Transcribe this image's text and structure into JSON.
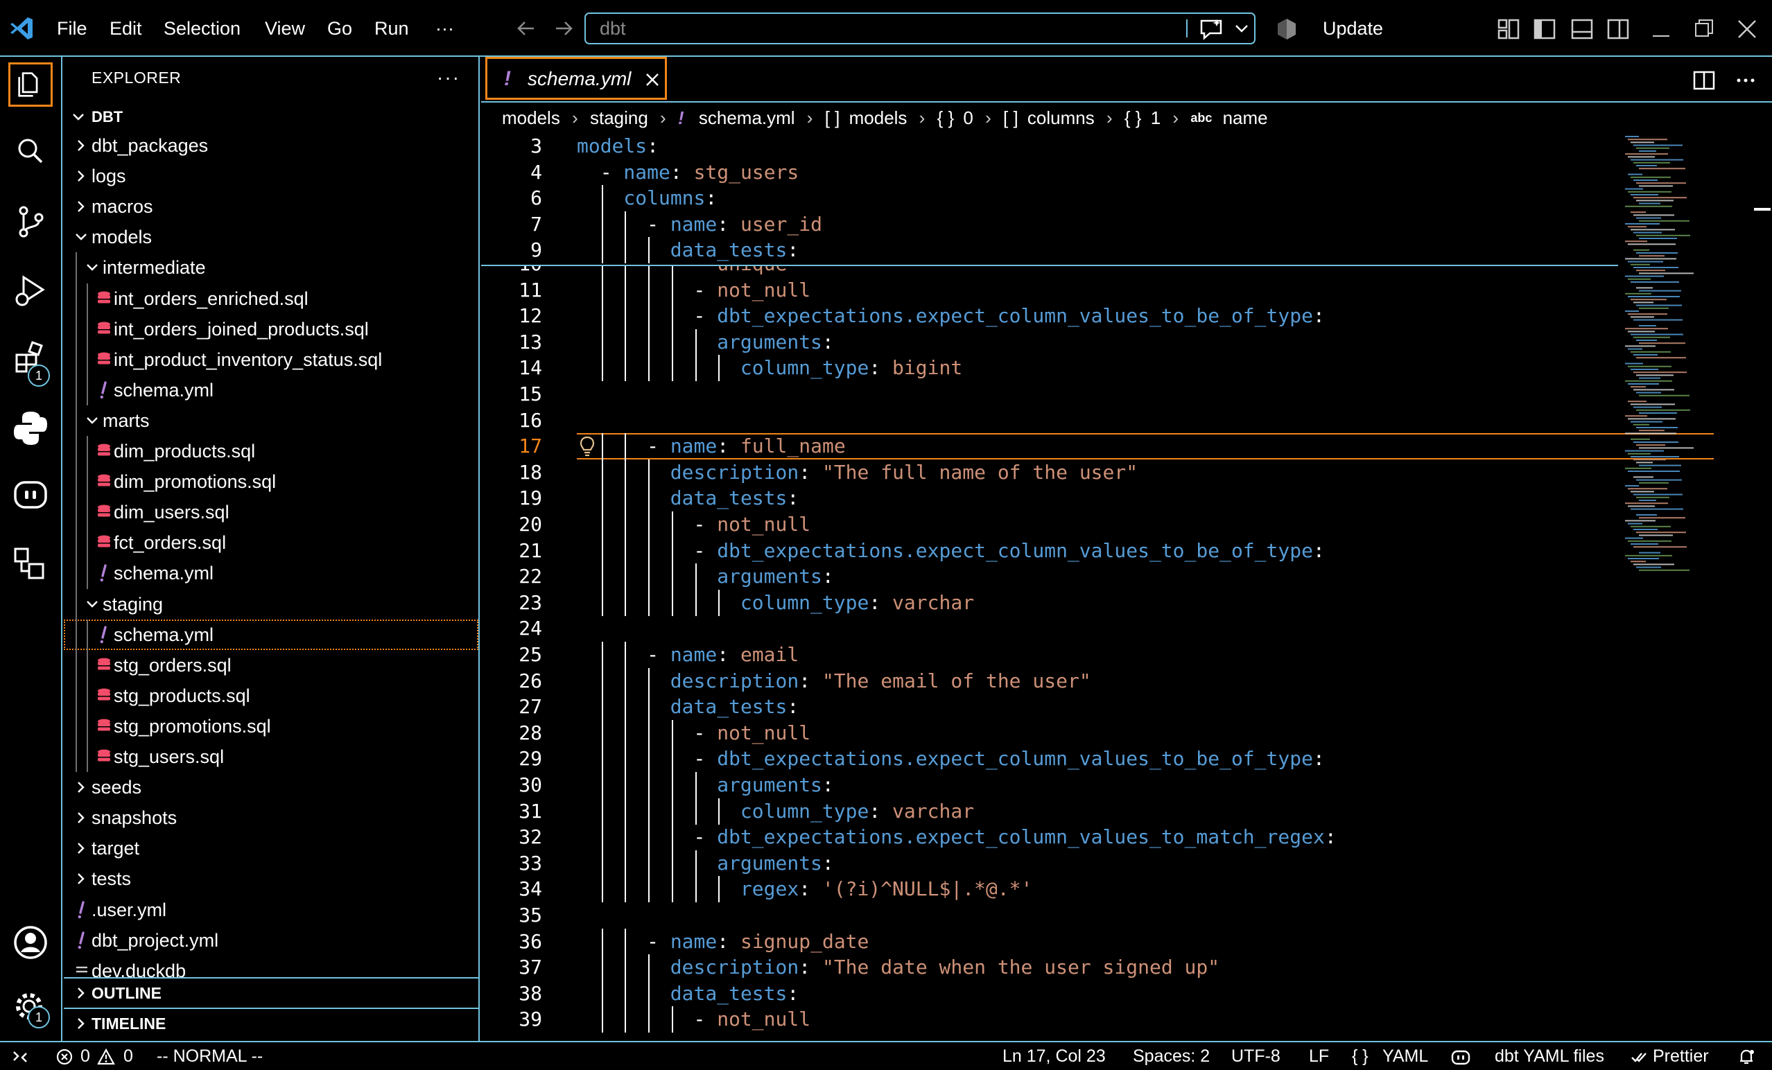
{
  "titlebar": {
    "menu": [
      "File",
      "Edit",
      "Selection",
      "View",
      "Go",
      "Run",
      "···"
    ],
    "search_text": "dbt",
    "update_label": "Update"
  },
  "activity_bar": {
    "icons": [
      "files-icon",
      "search-icon",
      "source-control-icon",
      "run-debug-icon",
      "extensions-icon",
      "python-icon",
      "copilot-icon",
      "remote-explorer-icon",
      "account-icon",
      "settings-gear-icon"
    ],
    "extensions_badge": "1",
    "settings_badge": "1"
  },
  "sidebar": {
    "title": "EXPLORER",
    "more": "···",
    "root": "DBT",
    "tree": [
      {
        "label": "dbt_packages",
        "type": "folder",
        "depth": 0,
        "expanded": false
      },
      {
        "label": "logs",
        "type": "folder",
        "depth": 0,
        "expanded": false
      },
      {
        "label": "macros",
        "type": "folder",
        "depth": 0,
        "expanded": false
      },
      {
        "label": "models",
        "type": "folder",
        "depth": 0,
        "expanded": true
      },
      {
        "label": "intermediate",
        "type": "folder",
        "depth": 1,
        "expanded": true
      },
      {
        "label": "int_orders_enriched.sql",
        "type": "sql",
        "depth": 2
      },
      {
        "label": "int_orders_joined_products.sql",
        "type": "sql",
        "depth": 2
      },
      {
        "label": "int_product_inventory_status.sql",
        "type": "sql",
        "depth": 2
      },
      {
        "label": "schema.yml",
        "type": "yml",
        "depth": 2
      },
      {
        "label": "marts",
        "type": "folder",
        "depth": 1,
        "expanded": true
      },
      {
        "label": "dim_products.sql",
        "type": "sql",
        "depth": 2
      },
      {
        "label": "dim_promotions.sql",
        "type": "sql",
        "depth": 2
      },
      {
        "label": "dim_users.sql",
        "type": "sql",
        "depth": 2
      },
      {
        "label": "fct_orders.sql",
        "type": "sql",
        "depth": 2
      },
      {
        "label": "schema.yml",
        "type": "yml",
        "depth": 2
      },
      {
        "label": "staging",
        "type": "folder",
        "depth": 1,
        "expanded": true
      },
      {
        "label": "schema.yml",
        "type": "yml",
        "depth": 2,
        "selected": true
      },
      {
        "label": "stg_orders.sql",
        "type": "sql",
        "depth": 2
      },
      {
        "label": "stg_products.sql",
        "type": "sql",
        "depth": 2
      },
      {
        "label": "stg_promotions.sql",
        "type": "sql",
        "depth": 2
      },
      {
        "label": "stg_users.sql",
        "type": "sql",
        "depth": 2
      },
      {
        "label": "seeds",
        "type": "folder",
        "depth": 0,
        "expanded": false
      },
      {
        "label": "snapshots",
        "type": "folder",
        "depth": 0,
        "expanded": false
      },
      {
        "label": "target",
        "type": "folder",
        "depth": 0,
        "expanded": false
      },
      {
        "label": "tests",
        "type": "folder",
        "depth": 0,
        "expanded": false
      },
      {
        "label": ".user.yml",
        "type": "yml",
        "depth": 0
      },
      {
        "label": "dbt_project.yml",
        "type": "yml",
        "depth": 0
      },
      {
        "label": "dev.duckdb",
        "type": "file",
        "depth": 0
      }
    ],
    "outline_label": "OUTLINE",
    "timeline_label": "TIMELINE"
  },
  "editor": {
    "tab": {
      "icon": "!",
      "label": "schema.yml"
    },
    "breadcrumbs": [
      "models",
      "staging",
      "schema.yml",
      "models",
      "0",
      "columns",
      "1",
      "name"
    ],
    "breadcrumb_symbols": {
      "yaml": "!",
      "array": "[ ]",
      "object": "{ }",
      "string": "abc"
    },
    "sticky_lines": [
      {
        "n": "3",
        "indent": 0,
        "tokens": [
          {
            "t": "models",
            "c": "k"
          },
          {
            "t": ":",
            "c": "p"
          }
        ]
      },
      {
        "n": "4",
        "indent": 1,
        "tokens": [
          {
            "t": "- ",
            "c": "p"
          },
          {
            "t": "name",
            "c": "k"
          },
          {
            "t": ": ",
            "c": "p"
          },
          {
            "t": "stg_users",
            "c": "s"
          }
        ]
      },
      {
        "n": "6",
        "indent": 2,
        "tokens": [
          {
            "t": "columns",
            "c": "k"
          },
          {
            "t": ":",
            "c": "p"
          }
        ]
      },
      {
        "n": "7",
        "indent": 3,
        "tokens": [
          {
            "t": "- ",
            "c": "p"
          },
          {
            "t": "name",
            "c": "k"
          },
          {
            "t": ": ",
            "c": "p"
          },
          {
            "t": "user_id",
            "c": "s"
          }
        ]
      },
      {
        "n": "9",
        "indent": 4,
        "tokens": [
          {
            "t": "data_tests",
            "c": "k"
          },
          {
            "t": ":",
            "c": "p"
          }
        ]
      }
    ],
    "lines": [
      {
        "n": "10",
        "indent": 5,
        "tokens": [
          {
            "t": "- ",
            "c": "p"
          },
          {
            "t": "unique",
            "c": "s"
          }
        ]
      },
      {
        "n": "11",
        "indent": 5,
        "tokens": [
          {
            "t": "- ",
            "c": "p"
          },
          {
            "t": "not_null",
            "c": "s"
          }
        ]
      },
      {
        "n": "12",
        "indent": 5,
        "tokens": [
          {
            "t": "- ",
            "c": "p"
          },
          {
            "t": "dbt_expectations.expect_column_values_to_be_of_type",
            "c": "k"
          },
          {
            "t": ":",
            "c": "p"
          }
        ]
      },
      {
        "n": "13",
        "indent": 6,
        "tokens": [
          {
            "t": "arguments",
            "c": "k"
          },
          {
            "t": ":",
            "c": "p"
          }
        ]
      },
      {
        "n": "14",
        "indent": 7,
        "tokens": [
          {
            "t": "column_type",
            "c": "k"
          },
          {
            "t": ": ",
            "c": "p"
          },
          {
            "t": "bigint",
            "c": "s"
          }
        ]
      },
      {
        "n": "15",
        "indent": 0,
        "tokens": []
      },
      {
        "n": "16",
        "indent": 0,
        "tokens": []
      },
      {
        "n": "17",
        "indent": 3,
        "current": true,
        "tokens": [
          {
            "t": "- ",
            "c": "p"
          },
          {
            "t": "name",
            "c": "k"
          },
          {
            "t": ": ",
            "c": "p"
          },
          {
            "t": "full_name",
            "c": "s"
          }
        ]
      },
      {
        "n": "18",
        "indent": 4,
        "tokens": [
          {
            "t": "description",
            "c": "k"
          },
          {
            "t": ": ",
            "c": "p"
          },
          {
            "t": "\"The full name of the user\"",
            "c": "s"
          }
        ]
      },
      {
        "n": "19",
        "indent": 4,
        "tokens": [
          {
            "t": "data_tests",
            "c": "k"
          },
          {
            "t": ":",
            "c": "p"
          }
        ]
      },
      {
        "n": "20",
        "indent": 5,
        "tokens": [
          {
            "t": "- ",
            "c": "p"
          },
          {
            "t": "not_null",
            "c": "s"
          }
        ]
      },
      {
        "n": "21",
        "indent": 5,
        "tokens": [
          {
            "t": "- ",
            "c": "p"
          },
          {
            "t": "dbt_expectations.expect_column_values_to_be_of_type",
            "c": "k"
          },
          {
            "t": ":",
            "c": "p"
          }
        ]
      },
      {
        "n": "22",
        "indent": 6,
        "tokens": [
          {
            "t": "arguments",
            "c": "k"
          },
          {
            "t": ":",
            "c": "p"
          }
        ]
      },
      {
        "n": "23",
        "indent": 7,
        "tokens": [
          {
            "t": "column_type",
            "c": "k"
          },
          {
            "t": ": ",
            "c": "p"
          },
          {
            "t": "varchar",
            "c": "s"
          }
        ]
      },
      {
        "n": "24",
        "indent": 0,
        "tokens": []
      },
      {
        "n": "25",
        "indent": 3,
        "tokens": [
          {
            "t": "- ",
            "c": "p"
          },
          {
            "t": "name",
            "c": "k"
          },
          {
            "t": ": ",
            "c": "p"
          },
          {
            "t": "email",
            "c": "s"
          }
        ]
      },
      {
        "n": "26",
        "indent": 4,
        "tokens": [
          {
            "t": "description",
            "c": "k"
          },
          {
            "t": ": ",
            "c": "p"
          },
          {
            "t": "\"The email of the user\"",
            "c": "s"
          }
        ]
      },
      {
        "n": "27",
        "indent": 4,
        "tokens": [
          {
            "t": "data_tests",
            "c": "k"
          },
          {
            "t": ":",
            "c": "p"
          }
        ]
      },
      {
        "n": "28",
        "indent": 5,
        "tokens": [
          {
            "t": "- ",
            "c": "p"
          },
          {
            "t": "not_null",
            "c": "s"
          }
        ]
      },
      {
        "n": "29",
        "indent": 5,
        "tokens": [
          {
            "t": "- ",
            "c": "p"
          },
          {
            "t": "dbt_expectations.expect_column_values_to_be_of_type",
            "c": "k"
          },
          {
            "t": ":",
            "c": "p"
          }
        ]
      },
      {
        "n": "30",
        "indent": 6,
        "tokens": [
          {
            "t": "arguments",
            "c": "k"
          },
          {
            "t": ":",
            "c": "p"
          }
        ]
      },
      {
        "n": "31",
        "indent": 7,
        "tokens": [
          {
            "t": "column_type",
            "c": "k"
          },
          {
            "t": ": ",
            "c": "p"
          },
          {
            "t": "varchar",
            "c": "s"
          }
        ]
      },
      {
        "n": "32",
        "indent": 5,
        "tokens": [
          {
            "t": "- ",
            "c": "p"
          },
          {
            "t": "dbt_expectations.expect_column_values_to_match_regex",
            "c": "k"
          },
          {
            "t": ":",
            "c": "p"
          }
        ]
      },
      {
        "n": "33",
        "indent": 6,
        "tokens": [
          {
            "t": "arguments",
            "c": "k"
          },
          {
            "t": ":",
            "c": "p"
          }
        ]
      },
      {
        "n": "34",
        "indent": 7,
        "tokens": [
          {
            "t": "regex",
            "c": "k"
          },
          {
            "t": ": ",
            "c": "p"
          },
          {
            "t": "'(?i)^NULL$|.*@.*'",
            "c": "s"
          }
        ]
      },
      {
        "n": "35",
        "indent": 0,
        "tokens": []
      },
      {
        "n": "36",
        "indent": 3,
        "tokens": [
          {
            "t": "- ",
            "c": "p"
          },
          {
            "t": "name",
            "c": "k"
          },
          {
            "t": ": ",
            "c": "p"
          },
          {
            "t": "signup_date",
            "c": "s"
          }
        ]
      },
      {
        "n": "37",
        "indent": 4,
        "tokens": [
          {
            "t": "description",
            "c": "k"
          },
          {
            "t": ": ",
            "c": "p"
          },
          {
            "t": "\"The date when the user signed up\"",
            "c": "s"
          }
        ]
      },
      {
        "n": "38",
        "indent": 4,
        "tokens": [
          {
            "t": "data_tests",
            "c": "k"
          },
          {
            "t": ":",
            "c": "p"
          }
        ]
      },
      {
        "n": "39",
        "indent": 5,
        "tokens": [
          {
            "t": "- ",
            "c": "p"
          },
          {
            "t": "not_null",
            "c": "s"
          }
        ]
      }
    ]
  },
  "statusbar": {
    "errors": "0",
    "warnings": "0",
    "vim_mode": "-- NORMAL --",
    "cursor": "Ln 17, Col 23",
    "spaces": "Spaces: 2",
    "encoding": "UTF-8",
    "eol": "LF",
    "language": "YAML",
    "language_icon": "{ }",
    "schema": "dbt YAML files",
    "formatter": "Prettier"
  },
  "colors": {
    "border": "#6fc3df",
    "focus": "#f38518",
    "keyword": "#569cd6",
    "string": "#ce9178",
    "yaml_icon": "#b180d7",
    "db_icon": "#f14c6a"
  }
}
